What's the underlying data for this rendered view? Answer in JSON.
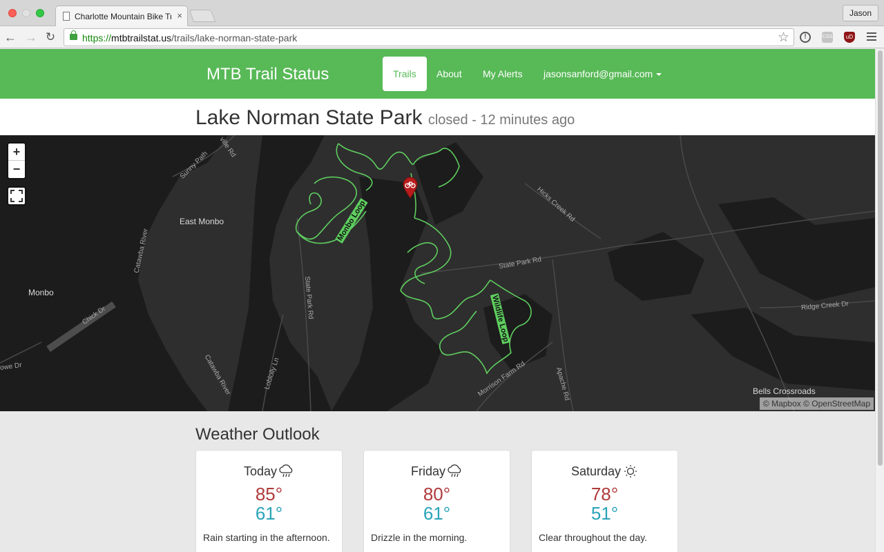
{
  "browser": {
    "tab_title": "Charlotte Mountain Bike Tra",
    "tab_close": "×",
    "profile_name": "Jason",
    "url_scheme": "https://",
    "url_host": "mtbtrailstat.us",
    "url_path": "/trails/lake-norman-state-park",
    "back_glyph": "←",
    "forward_glyph": "→",
    "reload_glyph": "↻",
    "star_glyph": "☆",
    "ext1_label": "!",
    "ext2_label": "CSS",
    "ext3_label": "uD"
  },
  "nav": {
    "brand": "MTB Trail Status",
    "links": [
      "Trails",
      "About",
      "My Alerts"
    ],
    "active_index": 0,
    "user_email": "jasonsanford@gmail.com"
  },
  "trail": {
    "name": "Lake Norman State Park",
    "status": "closed - 12 minutes ago"
  },
  "map": {
    "zoom_in": "+",
    "zoom_out": "−",
    "attribution": "© Mapbox © OpenStreetMap",
    "labels": {
      "east_monbo": "East Monbo",
      "monbo": "Monbo",
      "sunny_path": "Sunny Path",
      "hicks_creek_rd": "Hicks Creek Rd",
      "state_park_rd_1": "State Park Rd",
      "state_park_rd_2": "State Park Rd",
      "catawba_river_1": "Catawba River",
      "catawba_river_2": "Catawba River",
      "chick_dr": "Chick Dr",
      "ridge_creek_dr": "Ridge Creek Dr",
      "bells_crossroads": "Bells Crossroads",
      "loblolly_ln": "Loblolly Ln",
      "morrison_farm_rd": "Morrison Farm Rd",
      "apache_rd": "Apache Rd",
      "ville_rd": "ville Rd",
      "owe_dr": "owe Dr",
      "monbo_loop": "Monbo Loop",
      "wildlife_loop": "Wildlife Loop"
    }
  },
  "weather": {
    "title": "Weather Outlook",
    "days": [
      {
        "day": "Today",
        "icon": "rain-icon",
        "hi": "85°",
        "lo": "61°",
        "summary": "Rain starting in the afternoon."
      },
      {
        "day": "Friday",
        "icon": "rain-icon",
        "hi": "80°",
        "lo": "61°",
        "summary": "Drizzle in the morning."
      },
      {
        "day": "Saturday",
        "icon": "sun-icon",
        "hi": "78°",
        "lo": "51°",
        "summary": "Clear throughout the day."
      }
    ]
  },
  "colors": {
    "brand_green": "#58b957",
    "high_temp": "#b03a3a",
    "low_temp": "#2aa3b8",
    "map_land": "#2e2e2e",
    "map_water": "#1c1c1c",
    "trail_line": "#5fcf5f",
    "marker": "#b71c1c"
  }
}
